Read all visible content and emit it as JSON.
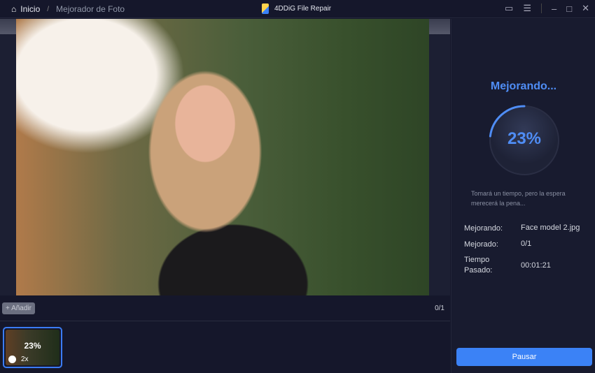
{
  "header": {
    "home_label": "Inicio",
    "separator": "/",
    "current_page": "Mejorador de Foto",
    "app_title": "4DDiG File Repair"
  },
  "toolbar": {
    "add_label": "+ Añadir",
    "count": "0/1"
  },
  "thumbnail": {
    "progress": "23%",
    "scale": "2x"
  },
  "panel": {
    "title": "Mejorando...",
    "progress_percent": 23,
    "progress_label": "23%",
    "hint": "Tomará un tiempo, pero la espera merecerá la pena...",
    "rows": [
      {
        "label": "Mejorando:",
        "value": "Face model 2.jpg"
      },
      {
        "label": "Mejorado:",
        "value": "0/1"
      },
      {
        "label": "Tiempo Pasado:",
        "value": "00:01:21"
      }
    ],
    "pause_label": "Pausar"
  },
  "colors": {
    "accent": "#3b82f6",
    "background": "#15172b"
  }
}
